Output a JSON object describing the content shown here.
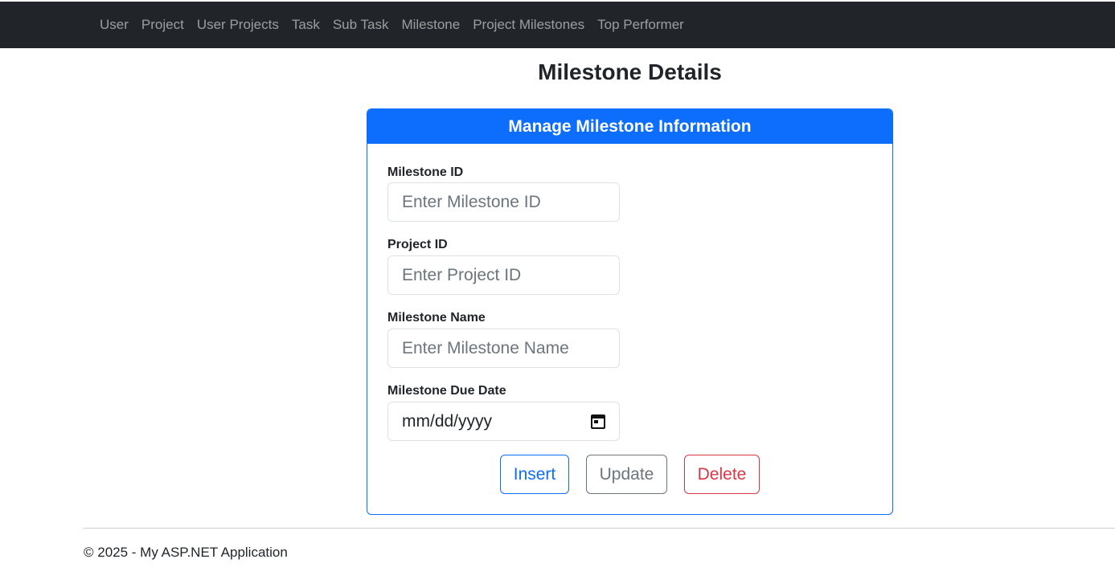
{
  "nav": {
    "links": [
      {
        "label": "User"
      },
      {
        "label": "Project"
      },
      {
        "label": "User Projects"
      },
      {
        "label": "Task"
      },
      {
        "label": "Sub Task"
      },
      {
        "label": "Milestone"
      },
      {
        "label": "Project Milestones"
      },
      {
        "label": "Top Performer"
      }
    ]
  },
  "page": {
    "title": "Milestone Details"
  },
  "card": {
    "header": "Manage Milestone Information",
    "fields": {
      "milestone_id": {
        "label": "Milestone ID",
        "placeholder": "Enter Milestone ID",
        "value": ""
      },
      "project_id": {
        "label": "Project ID",
        "placeholder": "Enter Project ID",
        "value": ""
      },
      "milestone_name": {
        "label": "Milestone Name",
        "placeholder": "Enter Milestone Name",
        "value": ""
      },
      "due_date": {
        "label": "Milestone Due Date",
        "placeholder": "mm/dd/yyyy",
        "icon": "calendar-icon"
      }
    },
    "buttons": {
      "insert": "Insert",
      "update": "Update",
      "delete": "Delete"
    }
  },
  "footer": {
    "text": "© 2025 - My ASP.NET Application"
  },
  "colors": {
    "navbar": "#212529",
    "primary": "#0d6efd",
    "secondary": "#6c757d",
    "danger": "#dc3545"
  }
}
